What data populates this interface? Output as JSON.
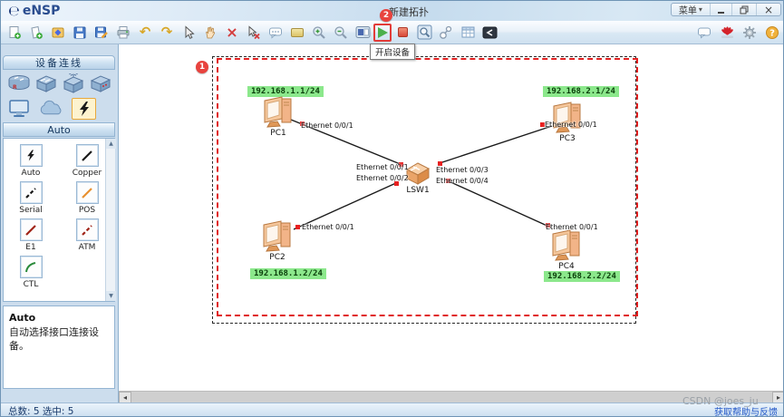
{
  "window": {
    "logo_text": "eNSP",
    "title": "新建拓扑",
    "menu_label": "菜单"
  },
  "toolbar": {
    "start_tooltip": "开启设备",
    "badge_canvas": "1",
    "badge_start": "2"
  },
  "sidebar": {
    "panel_title": "设备连线",
    "section_title": "Auto",
    "connections": [
      {
        "label": "Auto"
      },
      {
        "label": "Copper"
      },
      {
        "label": "Serial"
      },
      {
        "label": "POS"
      },
      {
        "label": "E1"
      },
      {
        "label": "ATM"
      },
      {
        "label": "CTL"
      }
    ],
    "description": {
      "title": "Auto",
      "text": "自动选择接口连接设备。"
    }
  },
  "canvas": {
    "pc1": {
      "label": "PC1",
      "ip": "192.168.1.1/24",
      "port": "Ethernet 0/0/1"
    },
    "pc2": {
      "label": "PC2",
      "ip": "192.168.1.2/24",
      "port": "Ethernet 0/0/1"
    },
    "pc3": {
      "label": "PC3",
      "ip": "192.168.2.1/24",
      "port": "Ethernet 0/0/1"
    },
    "pc4": {
      "label": "PC4",
      "ip": "192.168.2.2/24",
      "port": "Ethernet 0/0/1"
    },
    "lsw1": {
      "label": "LSW1",
      "ports": [
        "Ethernet 0/0/1",
        "Ethernet 0/0/2",
        "Ethernet 0/0/3",
        "Ethernet 0/0/4"
      ]
    }
  },
  "statusbar": {
    "summary": "总数: 5 选中: 5",
    "help_link": "获取帮助与反馈"
  },
  "watermark": "CSDN @joes_ju",
  "colors": {
    "ip_tag_green": "#8ce88c",
    "annotation_red": "#e23c39",
    "selection_red": "#e02020"
  }
}
